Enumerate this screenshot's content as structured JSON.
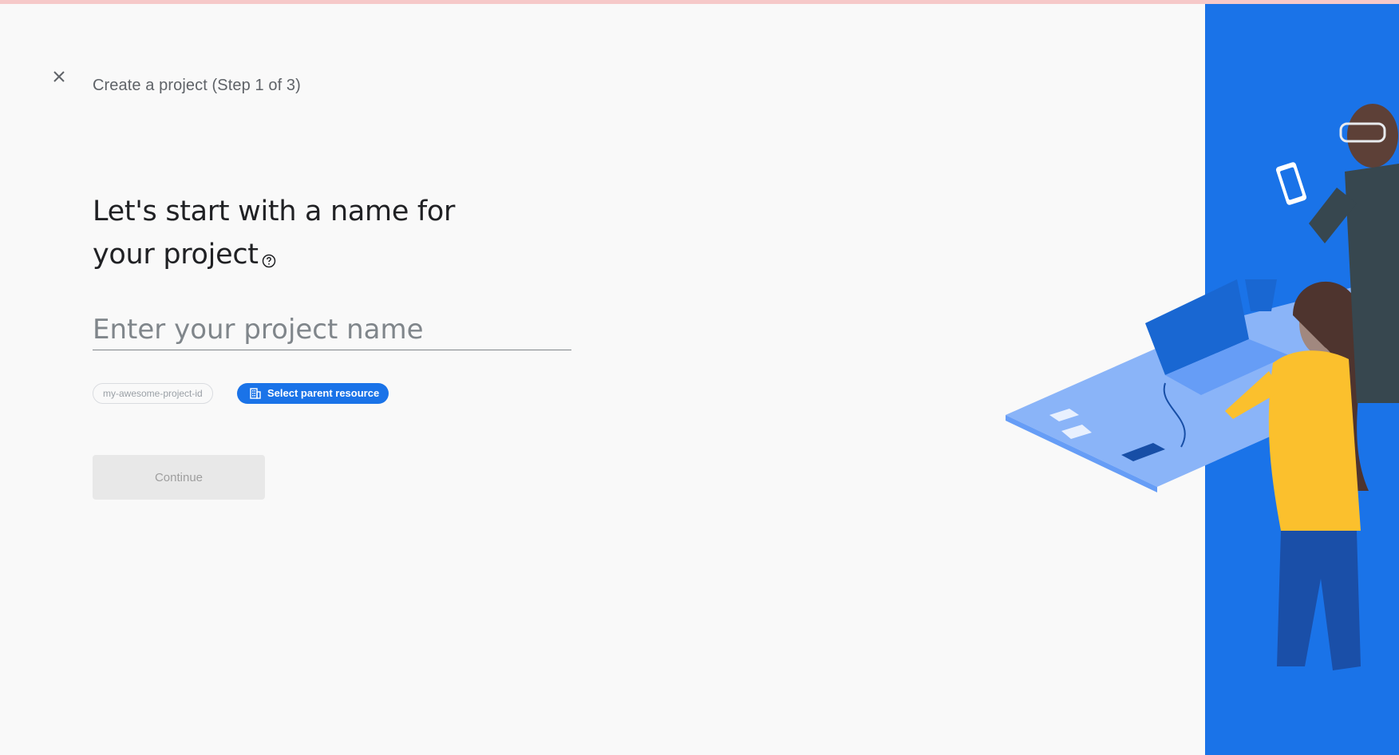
{
  "header": {
    "title": "Create a project (Step 1 of 3)",
    "close_icon": "close-icon"
  },
  "main": {
    "headline": "Let's start with a name for your project",
    "help_icon": "help-icon",
    "project_name_input": {
      "value": "",
      "placeholder": "Enter your project name"
    },
    "project_id_chip": "my-awesome-project-id",
    "parent_resource_chip": {
      "label": "Select parent resource",
      "icon": "building-icon"
    },
    "continue_label": "Continue"
  },
  "colors": {
    "accent": "#1a73e8",
    "background": "#f9f9f9",
    "panel": "#1a73e8"
  }
}
